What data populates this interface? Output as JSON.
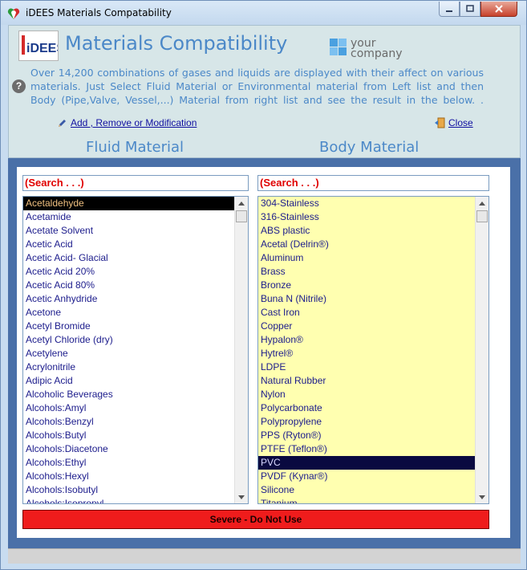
{
  "window": {
    "title": "iDEES Materials Compatability"
  },
  "header": {
    "logo_text": "iDEES",
    "heading": "Materials Compatibility",
    "company_line1": "your",
    "company_line2": "company",
    "description": "Over 14,200 combinations of gases and liquids are displayed with their affect on various materials. Just Select Fluid Material or Environmental material from Left list and then Body (Pipe,Valve, Vessel,...) Material from right list and see the result in the below.",
    "description_trail": ".",
    "add_link": "Add , Remove or Modification",
    "close_link": "Close",
    "fluid_heading": "Fluid Material",
    "body_heading": "Body Material"
  },
  "fluid": {
    "search_text": "(Search . . .)",
    "items": [
      "Acetaldehyde",
      "Acetamide",
      "Acetate Solvent",
      "Acetic Acid",
      "Acetic Acid-  Glacial",
      "Acetic Acid 20%",
      "Acetic Acid 80%",
      "Acetic Anhydride",
      "Acetone",
      "Acetyl Bromide",
      "Acetyl Chloride (dry)",
      "Acetylene",
      "Acrylonitrile",
      "Adipic Acid",
      "Alcoholic  Beverages",
      "Alcohols:Amyl",
      "Alcohols:Benzyl",
      "Alcohols:Butyl",
      "Alcohols:Diacetone",
      "Alcohols:Ethyl",
      "Alcohols:Hexyl",
      "Alcohols:Isobutyl",
      "Alcohols:Isopropyl"
    ],
    "selected_index": 0
  },
  "body": {
    "search_text": "(Search . . .)",
    "items": [
      "304-Stainless",
      "316-Stainless",
      "ABS plastic",
      "Acetal (Delrin®)",
      "Aluminum",
      "Brass",
      "Bronze",
      "Buna N (Nitrile)",
      "Cast Iron",
      "Copper",
      "Hypalon®",
      "Hytrel®",
      "LDPE",
      "Natural Rubber",
      "Nylon",
      "Polycarbonate",
      "Polypropylene",
      "PPS (Ryton®)",
      "PTFE (Teflon®)",
      "PVC",
      "PVDF (Kynar®)",
      "Silicone",
      "Titanium"
    ],
    "selected_index": 19
  },
  "result": {
    "text": "Severe - Do Not Use",
    "color": "#ef1c1c"
  },
  "colors": {
    "accent_blue": "#4b88c8",
    "content_frame": "#4a70a8",
    "body_list_bg": "#ffffb0",
    "search_red": "#e00000"
  },
  "icons": {
    "app": "italy-heart-icon",
    "help": "question-icon",
    "edit": "pencil-icon",
    "exit": "exit-door-icon"
  }
}
